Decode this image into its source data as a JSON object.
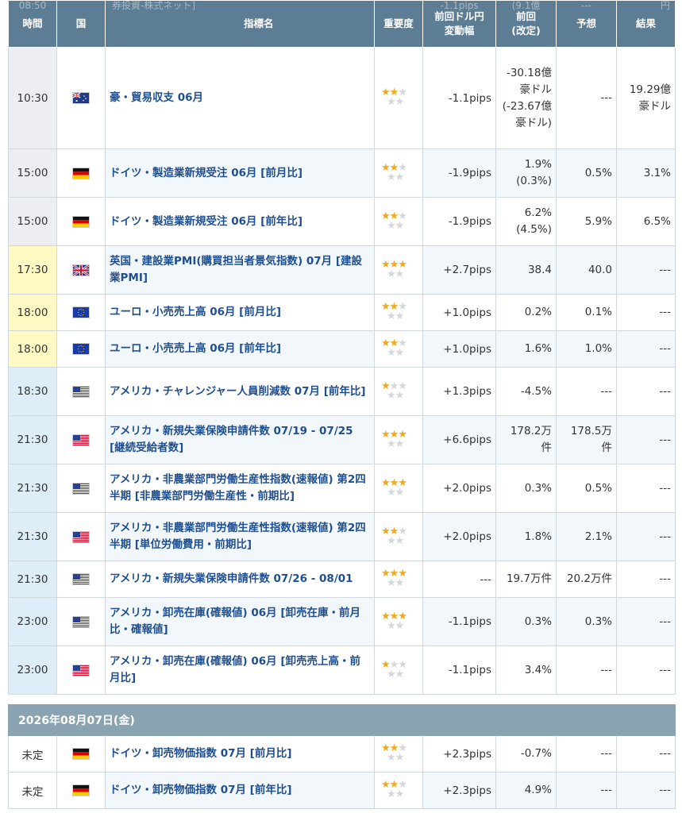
{
  "header": {
    "time": "時間",
    "country": "国",
    "indicator": "指標名",
    "importance": "重要度",
    "change": "前回ドル円\n変動幅",
    "previous": "前回\n(改定)",
    "forecast": "予想",
    "result": "結果",
    "ghost_time": "08:50",
    "ghost_indicator": "券投資-株式ネット]",
    "ghost_change": "-1.1pips",
    "ghost_previous": "(9.1億",
    "ghost_forecast": "---",
    "ghost_result": "円"
  },
  "rows": [
    {
      "time": "10:30",
      "flag": "australia-flag",
      "name": "豪・貿易収支 06月",
      "stars": 2,
      "pips": "-1.1pips",
      "prev": "-30.18億豪ドル(-23.67億豪ドル)",
      "fc": "---",
      "res": "19.29億豪ドル"
    },
    {
      "time": "15:00",
      "flag": "germany-flag",
      "name": "ドイツ・製造業新規受注 06月 [前月比]",
      "stars": 2,
      "pips": "-1.9pips",
      "prev": "1.9%\n(0.3%)",
      "fc": "0.5%",
      "res": "3.1%"
    },
    {
      "time": "15:00",
      "flag": "germany-flag",
      "name": "ドイツ・製造業新規受注 06月 [前年比]",
      "stars": 2,
      "pips": "-1.9pips",
      "prev": "6.2%\n(4.5%)",
      "fc": "5.9%",
      "res": "6.5%"
    },
    {
      "time": "17:30",
      "flag": "uk-flag",
      "name": "英国・建設業PMI(購買担当者景気指数) 07月 [建設業PMI]",
      "stars": 3,
      "pips": "+2.7pips",
      "prev": "38.4",
      "fc": "40.0",
      "res": "---"
    },
    {
      "time": "18:00",
      "flag": "eu-flag",
      "name": "ユーロ・小売売上高 06月 [前月比]",
      "stars": 2,
      "pips": "+1.0pips",
      "prev": "0.2%",
      "fc": "0.1%",
      "res": "---"
    },
    {
      "time": "18:00",
      "flag": "eu-flag",
      "name": "ユーロ・小売売上高 06月 [前年比]",
      "stars": 2,
      "pips": "+1.0pips",
      "prev": "1.6%",
      "fc": "1.0%",
      "res": "---"
    },
    {
      "time": "18:30",
      "flag": "us-flag",
      "name": "アメリカ・チャレンジャー人員削減数 07月 [前年比]",
      "stars": 1,
      "pips": "+1.3pips",
      "prev": "-4.5%",
      "fc": "---",
      "res": "---"
    },
    {
      "time": "21:30",
      "flag": "us-flag",
      "name": "アメリカ・新規失業保険申請件数 07/19 - 07/25 [継続受給者数]",
      "stars": 3,
      "pips": "+6.6pips",
      "prev": "178.2万件",
      "fc": "178.5万件",
      "res": "---"
    },
    {
      "time": "21:30",
      "flag": "us-flag",
      "name": "アメリカ・非農業部門労働生産性指数(速報値) 第2四半期 [非農業部門労働生産性・前期比]",
      "stars": 3,
      "pips": "+2.0pips",
      "prev": "0.3%",
      "fc": "0.5%",
      "res": "---"
    },
    {
      "time": "21:30",
      "flag": "us-flag",
      "name": "アメリカ・非農業部門労働生産性指数(速報値) 第2四半期 [単位労働費用・前期比]",
      "stars": 2,
      "pips": "+2.0pips",
      "prev": "1.8%",
      "fc": "2.1%",
      "res": "---"
    },
    {
      "time": "21:30",
      "flag": "us-flag",
      "name": "アメリカ・新規失業保険申請件数 07/26 - 08/01",
      "stars": 3,
      "pips": "---",
      "prev": "19.7万件",
      "fc": "20.2万件",
      "res": "---"
    },
    {
      "time": "23:00",
      "flag": "us-flag",
      "name": "アメリカ・卸売在庫(確報値) 06月 [卸売在庫・前月比・確報値]",
      "stars": 3,
      "pips": "-1.1pips",
      "prev": "0.3%",
      "fc": "0.3%",
      "res": "---"
    },
    {
      "time": "23:00",
      "flag": "us-flag",
      "name": "アメリカ・卸売在庫(確報値) 06月 [卸売売上高・前月比]",
      "stars": 1,
      "pips": "-1.1pips",
      "prev": "3.4%",
      "fc": "---",
      "res": "---"
    }
  ],
  "next_date": "2026年08月07日(金)",
  "next_rows": [
    {
      "time": "未定",
      "flag": "germany-flag",
      "name": "ドイツ・卸売物価指数 07月 [前月比]",
      "stars": 2,
      "pips": "+2.3pips",
      "prev": "-0.7%",
      "fc": "---",
      "res": "---"
    },
    {
      "time": "未定",
      "flag": "germany-flag",
      "name": "ドイツ・卸売物価指数 07月 [前年比]",
      "stars": 2,
      "pips": "+2.3pips",
      "prev": "4.9%",
      "fc": "---",
      "res": "---"
    }
  ]
}
